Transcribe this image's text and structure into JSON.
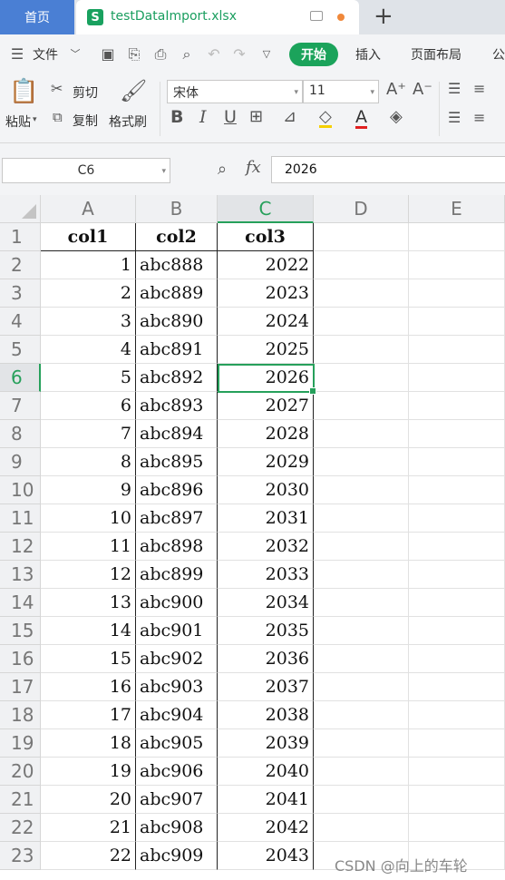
{
  "tabs": {
    "home": "首页",
    "file": "testDataImport.xlsx"
  },
  "menu": {
    "file": "文件",
    "start": "开始",
    "insert": "插入",
    "page_layout": "页面布局",
    "more": "公"
  },
  "ribbon": {
    "paste": "粘贴",
    "cut": "剪切",
    "copy": "复制",
    "format_painter": "格式刷",
    "font_name": "宋体",
    "font_size": "11",
    "bold": "B",
    "italic": "I",
    "underline": "U",
    "font_color_letter": "A"
  },
  "namebox": {
    "ref": "C6"
  },
  "formula": {
    "fx": "fx",
    "value": "2026"
  },
  "columns": [
    "A",
    "B",
    "C",
    "D",
    "E"
  ],
  "selected": {
    "column": "C",
    "row": "6"
  },
  "table": {
    "header": [
      "col1",
      "col2",
      "col3"
    ],
    "rows": [
      [
        "1",
        "abc888",
        "2022"
      ],
      [
        "2",
        "abc889",
        "2023"
      ],
      [
        "3",
        "abc890",
        "2024"
      ],
      [
        "4",
        "abc891",
        "2025"
      ],
      [
        "5",
        "abc892",
        "2026"
      ],
      [
        "6",
        "abc893",
        "2027"
      ],
      [
        "7",
        "abc894",
        "2028"
      ],
      [
        "8",
        "abc895",
        "2029"
      ],
      [
        "9",
        "abc896",
        "2030"
      ],
      [
        "10",
        "abc897",
        "2031"
      ],
      [
        "11",
        "abc898",
        "2032"
      ],
      [
        "12",
        "abc899",
        "2033"
      ],
      [
        "13",
        "abc900",
        "2034"
      ],
      [
        "14",
        "abc901",
        "2035"
      ],
      [
        "15",
        "abc902",
        "2036"
      ],
      [
        "16",
        "abc903",
        "2037"
      ],
      [
        "17",
        "abc904",
        "2038"
      ],
      [
        "18",
        "abc905",
        "2039"
      ],
      [
        "19",
        "abc906",
        "2040"
      ],
      [
        "20",
        "abc907",
        "2041"
      ],
      [
        "21",
        "abc908",
        "2042"
      ],
      [
        "22",
        "abc909",
        "2043"
      ]
    ]
  },
  "row_numbers": [
    "1",
    "2",
    "3",
    "4",
    "5",
    "6",
    "7",
    "8",
    "9",
    "10",
    "11",
    "12",
    "13",
    "14",
    "15",
    "16",
    "17",
    "18",
    "19",
    "20",
    "21",
    "22",
    "23"
  ],
  "watermark": "CSDN @向上的车轮",
  "colors": {
    "accent": "#1ba35b",
    "home_tab": "#4a7fd4",
    "unsaved_dot": "#f0883a"
  }
}
